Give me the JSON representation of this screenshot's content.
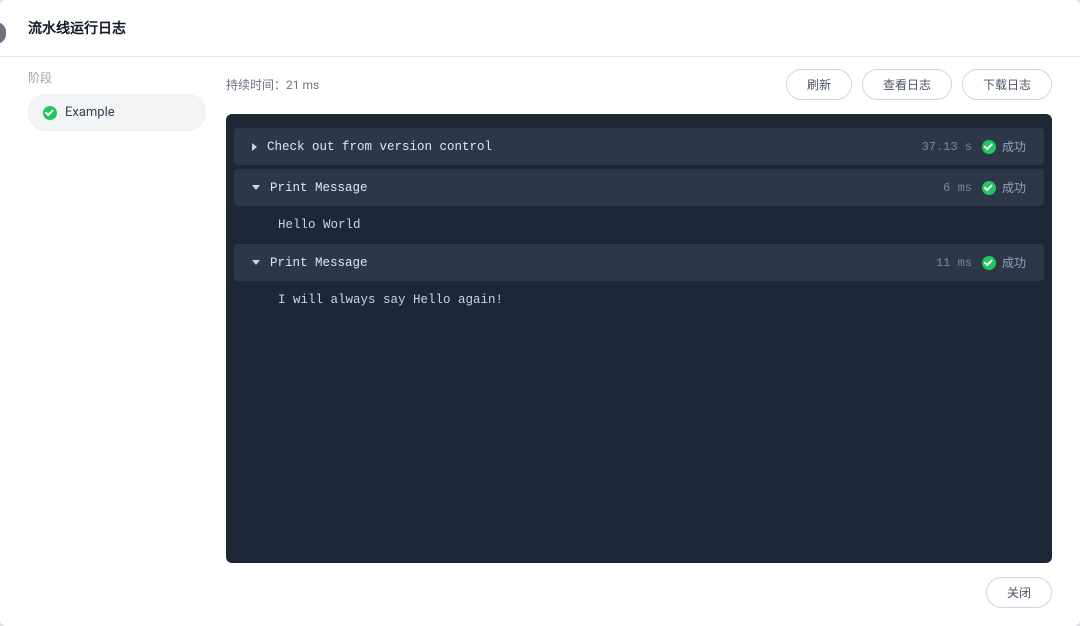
{
  "header": {
    "title": "流水线运行日志"
  },
  "sidebar": {
    "label": "阶段",
    "stages": [
      {
        "name": "Example",
        "status": "success"
      }
    ]
  },
  "main": {
    "duration_label": "持续时间：",
    "duration_value": "21 ms",
    "buttons": {
      "refresh": "刷新",
      "view_log": "查看日志",
      "download_log": "下载日志"
    },
    "steps": [
      {
        "name": "Check out from version control",
        "duration": "37.13 s",
        "status_label": "成功",
        "expanded": false,
        "output": ""
      },
      {
        "name": "Print Message",
        "duration": "6 ms",
        "status_label": "成功",
        "expanded": true,
        "output": "Hello World"
      },
      {
        "name": "Print Message",
        "duration": "11 ms",
        "status_label": "成功",
        "expanded": true,
        "output": "I will always say Hello again!"
      }
    ]
  },
  "footer": {
    "close": "关闭"
  }
}
